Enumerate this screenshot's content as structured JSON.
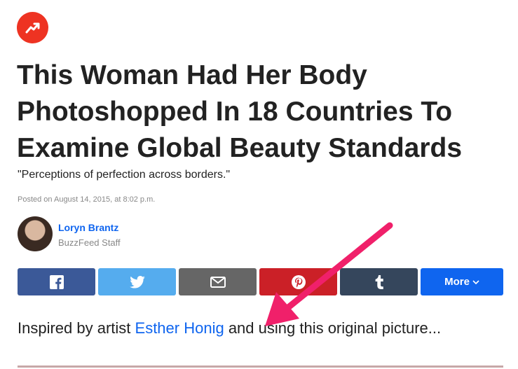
{
  "brand": {
    "logo_icon": "trending-arrow-icon",
    "color": "#ee3322"
  },
  "article": {
    "headline": "This Woman Had Her Body Photoshopped In 18 Countries To Examine Global Beauty Standards",
    "dek": "\"Perceptions of perfection across borders.\"",
    "posted": "Posted on August 14, 2015, at 8:02 p.m."
  },
  "author": {
    "name": "Loryn Brantz",
    "role": "BuzzFeed Staff"
  },
  "share": {
    "buttons": [
      {
        "icon": "facebook-icon",
        "color": "#3b5998"
      },
      {
        "icon": "twitter-icon",
        "color": "#55acee"
      },
      {
        "icon": "email-icon",
        "color": "#666666"
      },
      {
        "icon": "pinterest-icon",
        "color": "#cb2027"
      },
      {
        "icon": "tumblr-icon",
        "color": "#35465c"
      }
    ],
    "more_label": "More",
    "more_color": "#0f65ef"
  },
  "body": {
    "intro_before": "Inspired by artist ",
    "intro_link": "Esther Honig",
    "intro_after": " and using this original picture..."
  },
  "annotation": {
    "icon": "arrow-annotation-icon",
    "color": "#f0206a"
  }
}
